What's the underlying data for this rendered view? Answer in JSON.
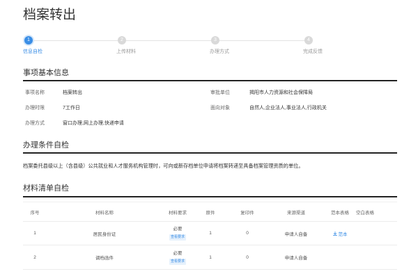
{
  "page": {
    "title": "档案转出"
  },
  "stepper": {
    "steps": [
      {
        "number": "1",
        "label": "信息自检",
        "active": true
      },
      {
        "number": "2",
        "label": "上传材料",
        "active": false
      },
      {
        "number": "3",
        "label": "办理方式",
        "active": false
      },
      {
        "number": "4",
        "label": "完成反馈",
        "active": false
      }
    ]
  },
  "basic_info": {
    "heading": "事项基本信息",
    "fields": {
      "item_name": {
        "label": "事项名称",
        "value": "档案转出"
      },
      "approval_unit": {
        "label": "审批单位",
        "value": "揭阳市人力资源和社会保障局"
      },
      "time_limit": {
        "label": "办理时限",
        "value": "7工作日"
      },
      "target": {
        "label": "面向对象",
        "value": "自然人,企业法人,事业法人,行政机关"
      },
      "method": {
        "label": "办理方式",
        "value": "窗口办理,网上办理,快递申请"
      }
    }
  },
  "conditions": {
    "heading": "办理条件自检",
    "text": "档案委托县级以上（含县级）公共就业和人才服务机构管理时，可向或新存档单位申请将档案转递至具备档案管理资质的单位。"
  },
  "materials": {
    "heading": "材料清单自检",
    "columns": [
      "序号",
      "材料名称",
      "材料要求",
      "原件",
      "复印件",
      "来源渠道",
      "范本表格",
      "空白表格"
    ],
    "rows": [
      {
        "index": "1",
        "name": "居民身份证",
        "requirement": "必要",
        "requirement_link": "查看要求",
        "original": "1",
        "copy": "0",
        "source": "申请人自备",
        "sample": {
          "icon": "download-icon",
          "label": "范本"
        }
      },
      {
        "index": "2",
        "name": "调档函件",
        "requirement": "必要",
        "requirement_link": "查看要求",
        "original": "1",
        "copy": "0",
        "source": "申请人自备"
      }
    ]
  },
  "colors": {
    "accent": "#3a8ee6",
    "step_inactive": "#d9d9d9",
    "heading_rule": "#222222",
    "badge_bg": "#e6f1fc"
  }
}
